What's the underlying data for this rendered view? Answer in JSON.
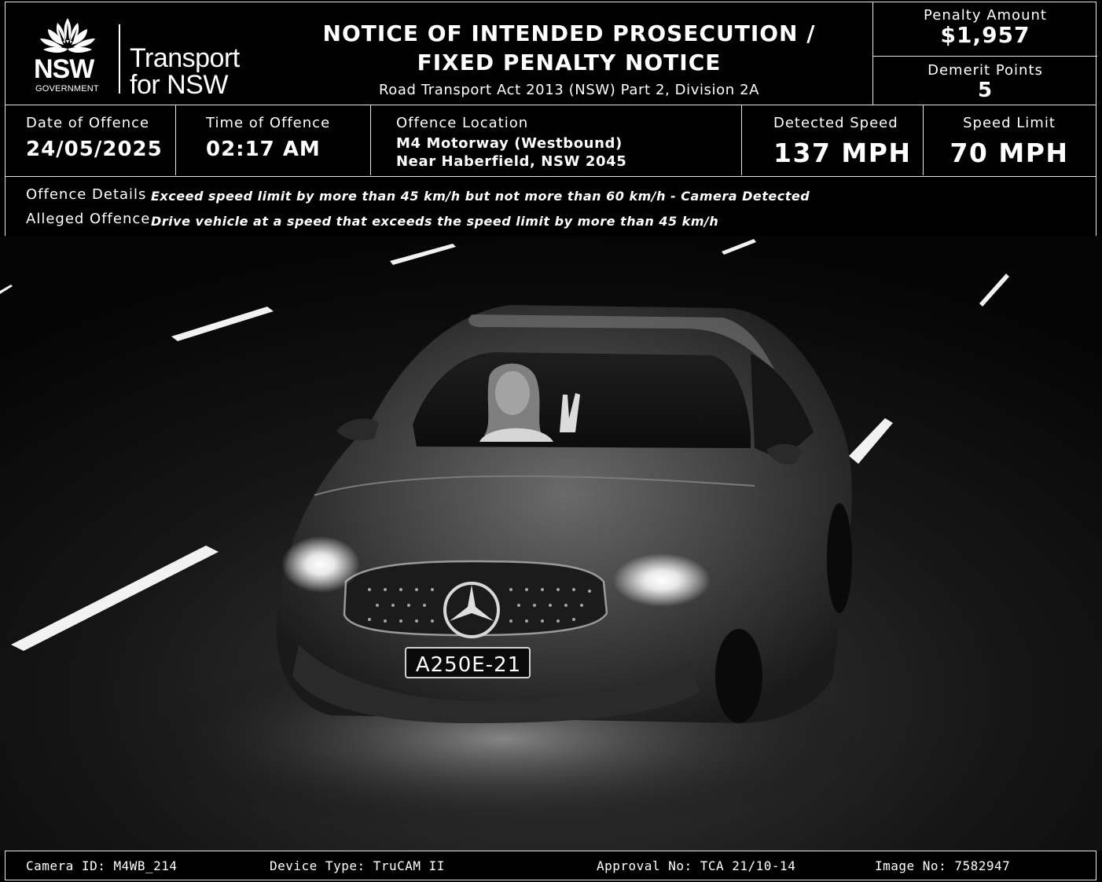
{
  "header": {
    "logo": {
      "nsw": "NSW",
      "government": "GOVERNMENT",
      "transport_line1": "Transport",
      "transport_line2": "for NSW"
    },
    "title_line1": "NOTICE OF INTENDED PROSECUTION /",
    "title_line2": "FIXED PENALTY NOTICE",
    "act": "Road Transport Act 2013 (NSW) Part 2, Division 2A",
    "penalty_label": "Penalty Amount",
    "penalty_value": "$1,957",
    "demerit_label": "Demerit Points",
    "demerit_value": "5"
  },
  "info": {
    "date_label": "Date of Offence",
    "date_value": "24/05/2025",
    "time_label": "Time of Offence",
    "time_value": "02:17 AM",
    "location_label": "Offence Location",
    "location_line1": "M4 Motorway (Westbound)",
    "location_line2": "Near Haberfield, NSW 2045",
    "detected_label": "Detected Speed",
    "detected_value": "137 MPH",
    "limit_label": "Speed Limit",
    "limit_value": "70 MPH"
  },
  "details": {
    "offence_details_label": "Offence Details",
    "offence_details_text": "Exceed speed limit by more than 45 km/h but not more than 60 km/h - Camera Detected",
    "alleged_label": "Alleged Offence",
    "alleged_text": "Drive vehicle at a speed that exceeds the speed limit by more than 45 km/h"
  },
  "photo": {
    "plate": "A250E-21",
    "colors": {
      "background": "#000000",
      "border": "#e6e6e6",
      "text": "#ffffff"
    }
  },
  "footer": {
    "camera": "Camera ID: M4WB_214",
    "device": "Device Type: TruCAM II",
    "approval": "Approval No: TCA 21/10-14",
    "image": "Image No: 7582947"
  }
}
